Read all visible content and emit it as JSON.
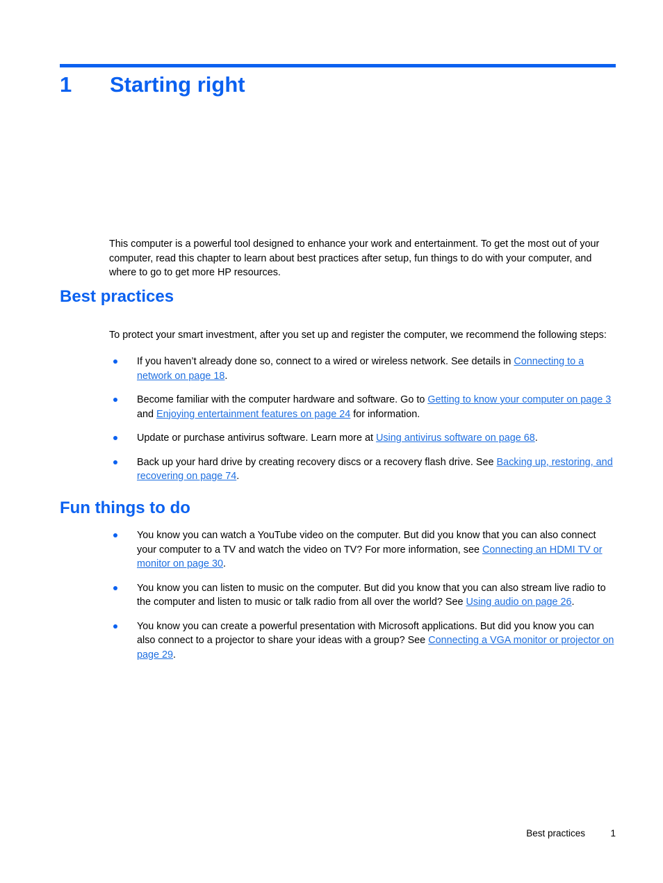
{
  "colors": {
    "accent": "#0b61f0",
    "link": "#1f6fe0",
    "text": "#000000",
    "background": "#ffffff"
  },
  "chapter": {
    "number": "1",
    "title": "Starting right"
  },
  "intro": {
    "paragraph": "This computer is a powerful tool designed to enhance your work and entertainment. To get the most out of your computer, read this chapter to learn about best practices after setup, fun things to do with your computer, and where to go to get more HP resources."
  },
  "sections": [
    {
      "heading": "Best practices",
      "lead": "To protect your smart investment, after you set up and register the computer, we recommend the following steps:",
      "bullets": [
        {
          "parts": [
            {
              "type": "text",
              "value": "If you haven’t already done so, connect to a wired or wireless network. See details in "
            },
            {
              "type": "link",
              "value": "Connecting to a network on page 18"
            },
            {
              "type": "text",
              "value": "."
            }
          ]
        },
        {
          "parts": [
            {
              "type": "text",
              "value": "Become familiar with the computer hardware and software. Go to "
            },
            {
              "type": "link",
              "value": "Getting to know your computer on page 3"
            },
            {
              "type": "text",
              "value": " and "
            },
            {
              "type": "link",
              "value": "Enjoying entertainment features on page 24"
            },
            {
              "type": "text",
              "value": " for information."
            }
          ]
        },
        {
          "parts": [
            {
              "type": "text",
              "value": "Update or purchase antivirus software. Learn more at "
            },
            {
              "type": "link",
              "value": "Using antivirus software on page 68"
            },
            {
              "type": "text",
              "value": "."
            }
          ]
        },
        {
          "parts": [
            {
              "type": "text",
              "value": "Back up your hard drive by creating recovery discs or a recovery flash drive. See "
            },
            {
              "type": "link",
              "value": "Backing up, restoring, and recovering on page 74"
            },
            {
              "type": "text",
              "value": "."
            }
          ]
        }
      ]
    },
    {
      "heading": "Fun things to do",
      "lead": "",
      "bullets": [
        {
          "parts": [
            {
              "type": "text",
              "value": "You know you can watch a YouTube video on the computer. But did you know that you can also connect your computer to a TV and watch the video on TV? For more information, see "
            },
            {
              "type": "link",
              "value": "Connecting an HDMI TV or monitor on page 30"
            },
            {
              "type": "text",
              "value": "."
            }
          ]
        },
        {
          "parts": [
            {
              "type": "text",
              "value": "You know you can listen to music on the computer. But did you know that you can also stream live radio to the computer and listen to music or talk radio from all over the world? See "
            },
            {
              "type": "link",
              "value": "Using audio on page 26"
            },
            {
              "type": "text",
              "value": "."
            }
          ]
        },
        {
          "parts": [
            {
              "type": "text",
              "value": "You know you can create a powerful presentation with Microsoft applications. But did you know you can also connect to a projector to share your ideas with a group? See "
            },
            {
              "type": "link",
              "value": "Connecting a VGA monitor or projector on page 29"
            },
            {
              "type": "text",
              "value": "."
            }
          ]
        }
      ]
    }
  ],
  "footer": {
    "section_label": "Best practices",
    "page_number": "1"
  }
}
